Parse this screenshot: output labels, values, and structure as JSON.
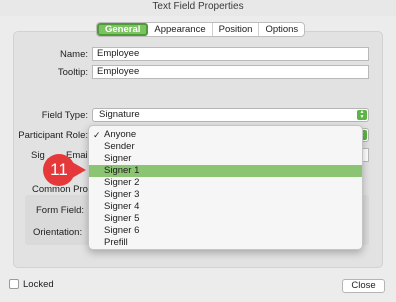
{
  "window": {
    "title": "Text Field Properties"
  },
  "tabs": [
    {
      "label": "General",
      "active": true
    },
    {
      "label": "Appearance",
      "active": false
    },
    {
      "label": "Position",
      "active": false
    },
    {
      "label": "Options",
      "active": false
    }
  ],
  "form": {
    "name_label": "Name:",
    "name_value": "Employee",
    "tooltip_label": "Tooltip:",
    "tooltip_value": "Employee",
    "field_type_label": "Field Type:",
    "field_type_value": "Signature",
    "participant_role_label": "Participant Role:",
    "signer_email_label_visible": "Sig",
    "signer_email_label_tail": "Email:",
    "common_props_label": "Common Prop",
    "form_field_label": "Form Field:",
    "orientation_label": "Orientation:"
  },
  "dropdown": {
    "checked_index": 0,
    "highlighted_index": 3,
    "options": [
      "Anyone",
      "Sender",
      "Signer",
      "Signer 1",
      "Signer 2",
      "Signer 3",
      "Signer 4",
      "Signer 5",
      "Signer 6",
      "Prefill"
    ]
  },
  "annotation": {
    "step_number": "11",
    "color": "#e5383b"
  },
  "footer": {
    "locked_label": "Locked",
    "close_label": "Close"
  },
  "colors": {
    "accent": "#7bc260",
    "highlight": "#8bc472",
    "stepper": "#5cb346"
  }
}
